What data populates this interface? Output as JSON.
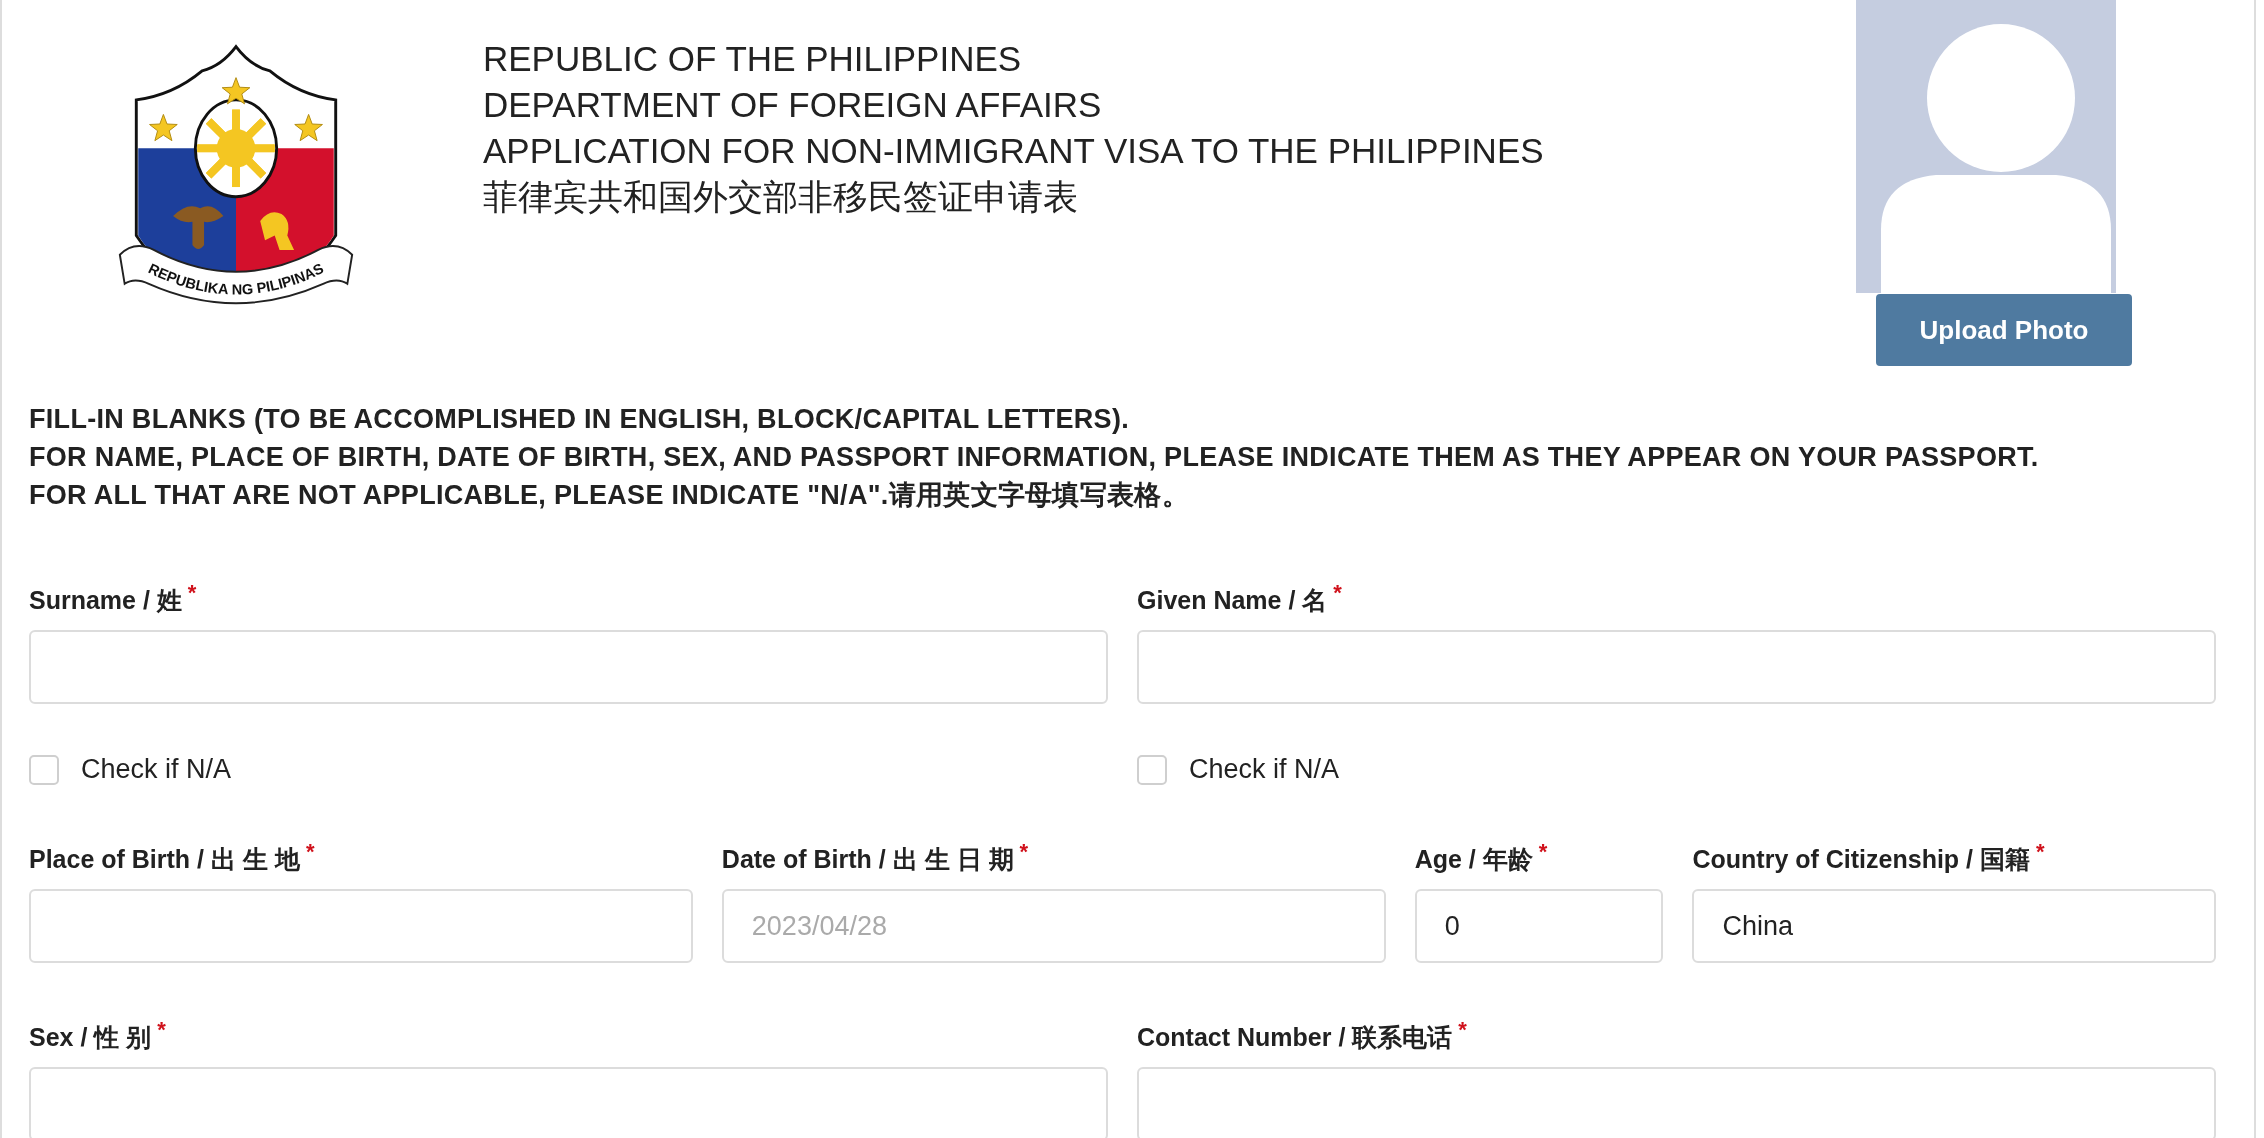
{
  "header": {
    "seal_text": "REPUBLIKA NG PILIPINAS",
    "title_lines": [
      "REPUBLIC OF THE PHILIPPINES",
      "DEPARTMENT OF FOREIGN AFFAIRS",
      "APPLICATION FOR NON-IMMIGRANT VISA TO THE PHILIPPINES",
      "菲律宾共和国外交部非移民签证申请表"
    ]
  },
  "photo": {
    "button": "Upload Photo"
  },
  "instructions": [
    "FILL-IN BLANKS (TO BE ACCOMPLISHED IN ENGLISH, BLOCK/CAPITAL LETTERS).",
    "FOR NAME, PLACE OF BIRTH, DATE OF BIRTH, SEX, AND PASSPORT INFORMATION, PLEASE INDICATE THEM AS THEY APPEAR ON YOUR PASSPORT.",
    "FOR ALL THAT ARE NOT APPLICABLE, PLEASE INDICATE \"N/A\".请用英文字母填写表格。"
  ],
  "rows": [
    {
      "kind": "pair",
      "fields": [
        {
          "label": "Surname / 姓",
          "required_mark": "*",
          "checkbox": {
            "label": "Check if N/A",
            "checked": false
          }
        },
        {
          "label": "Given Name / 名",
          "required_mark": "*",
          "checkbox": {
            "label": "Check if N/A",
            "checked": false
          }
        }
      ]
    },
    {
      "kind": "quad",
      "fields": [
        {
          "label": "Place of Birth / 出 生 地",
          "required_mark": "*"
        },
        {
          "label": "Date of Birth / 出 生 日 期",
          "required_mark": "*",
          "placeholder": "2023/04/28"
        },
        {
          "label": "Age / 年龄",
          "required_mark": "*",
          "value": "0"
        },
        {
          "label": "Country of Citizenship / 国籍",
          "required_mark": "*",
          "value": "China"
        }
      ]
    },
    {
      "kind": "pair",
      "fields": [
        {
          "label": "Sex / 性 别",
          "required_mark": "*"
        },
        {
          "label": "Contact Number / 联系电话",
          "required_mark": "*"
        }
      ]
    }
  ]
}
